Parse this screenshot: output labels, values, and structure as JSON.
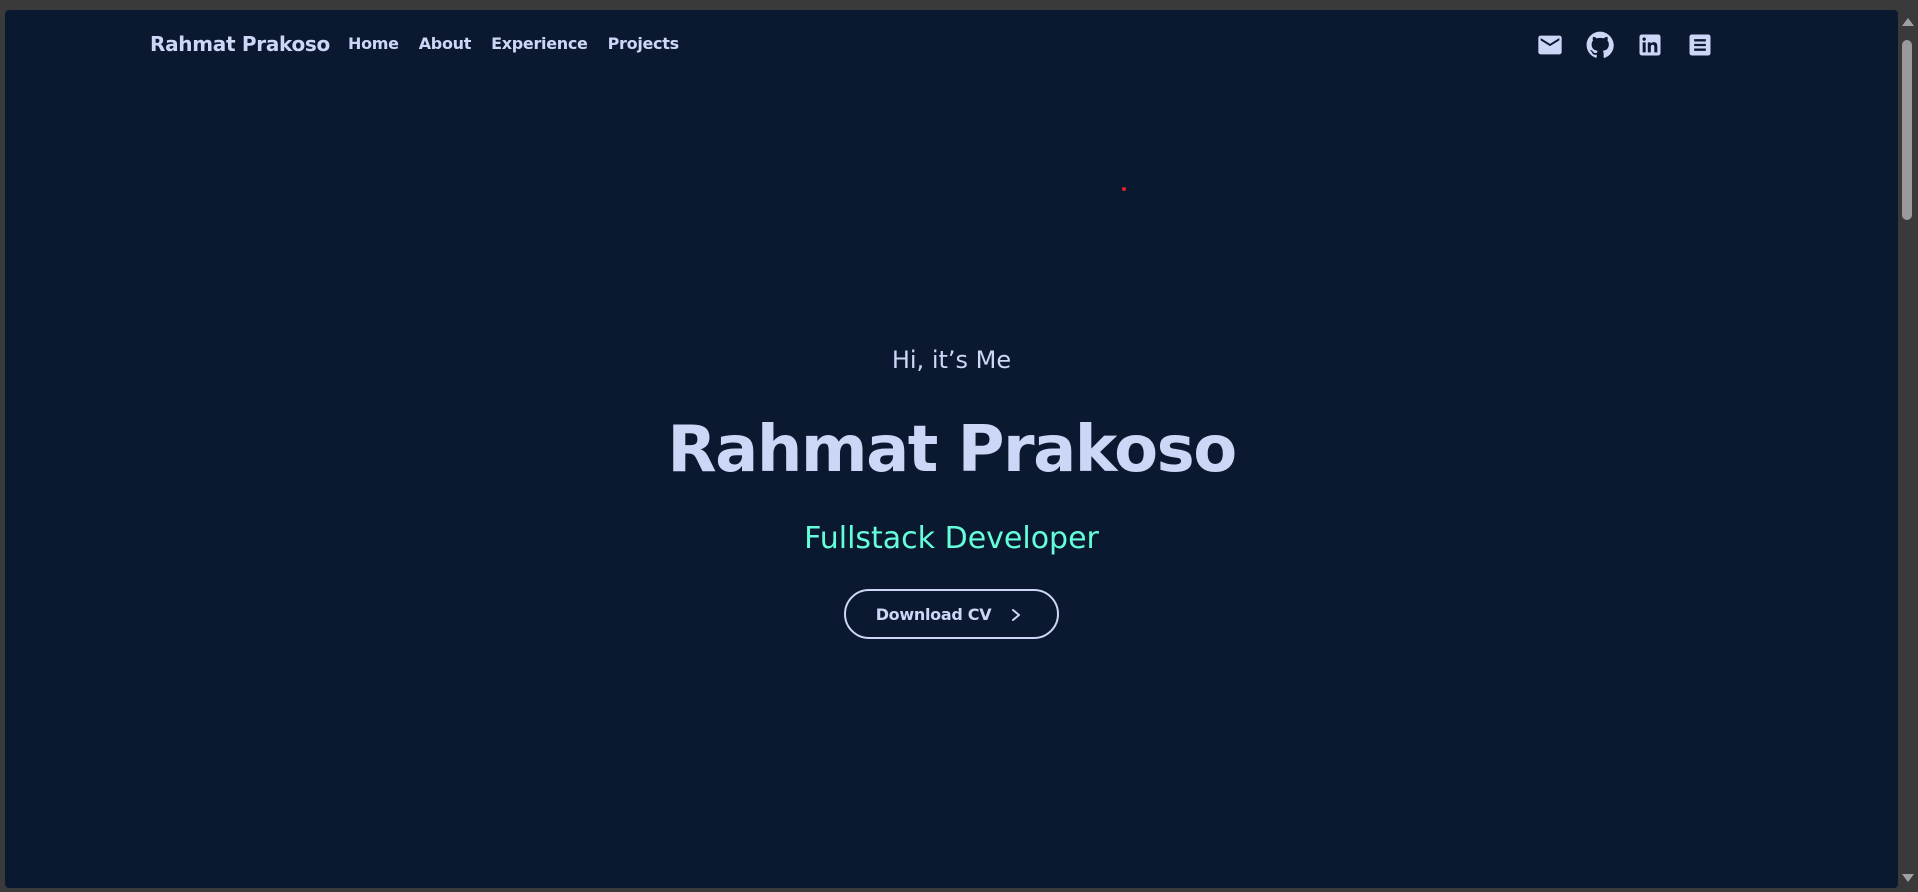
{
  "nav": {
    "brand": "Rahmat Prakoso",
    "links": [
      {
        "label": "Home"
      },
      {
        "label": "About"
      },
      {
        "label": "Experience"
      },
      {
        "label": "Projects"
      }
    ],
    "social": [
      {
        "icon": "mail-icon"
      },
      {
        "icon": "github-icon"
      },
      {
        "icon": "linkedin-icon"
      },
      {
        "icon": "document-icon"
      }
    ]
  },
  "hero": {
    "greeting": "Hi, it’s Me",
    "name": "Rahmat Prakoso",
    "role": "Fullstack Developer",
    "cta_label": "Download CV"
  },
  "colors": {
    "background": "#0b1930",
    "text": "#ccd6f6",
    "accent": "#64ffda"
  }
}
